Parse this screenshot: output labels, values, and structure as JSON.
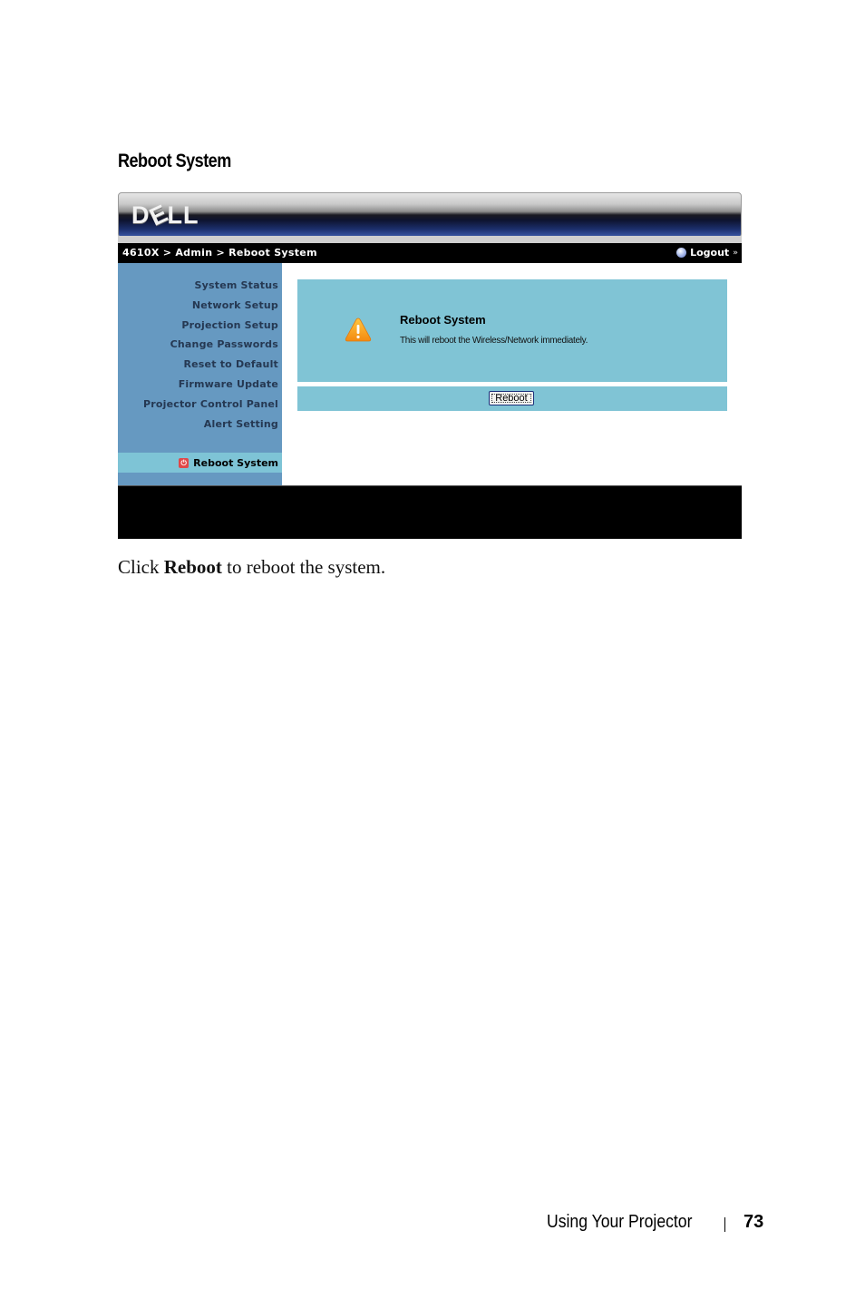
{
  "section": {
    "title": "Reboot System"
  },
  "screenshot": {
    "brand": {
      "logo_text_1": "D",
      "logo_text_2": "E",
      "logo_text_3": "LL"
    },
    "navbar": {
      "breadcrumb": "4610X > Admin > Reboot System",
      "logout_label": "Logout",
      "logout_arrows": "»"
    },
    "sidebar": {
      "items": [
        {
          "label": "System Status"
        },
        {
          "label": "Network Setup"
        },
        {
          "label": "Projection Setup"
        },
        {
          "label": "Change Passwords"
        },
        {
          "label": "Reset to Default"
        },
        {
          "label": "Firmware Update"
        },
        {
          "label": "Projector Control Panel"
        },
        {
          "label": "Alert Setting"
        }
      ],
      "active_item": {
        "label": "Reboot System",
        "icon": "power-icon"
      }
    },
    "content": {
      "icon": "warning-icon",
      "title": "Reboot System",
      "message": "This will reboot the Wireless/Network immediately.",
      "button_label": "Reboot"
    },
    "colors": {
      "sidebar_bg": "#6699c1",
      "active_bg": "#7ec4d6",
      "content_bg": "#80c4d5",
      "navbar_bg": "#000000",
      "warning": "#f5a020",
      "power": "#e0484a"
    }
  },
  "caption": {
    "prefix": "Click ",
    "bold": "Reboot",
    "suffix": " to reboot the system."
  },
  "footer": {
    "chapter": "Using Your Projector",
    "page_number": "73"
  }
}
